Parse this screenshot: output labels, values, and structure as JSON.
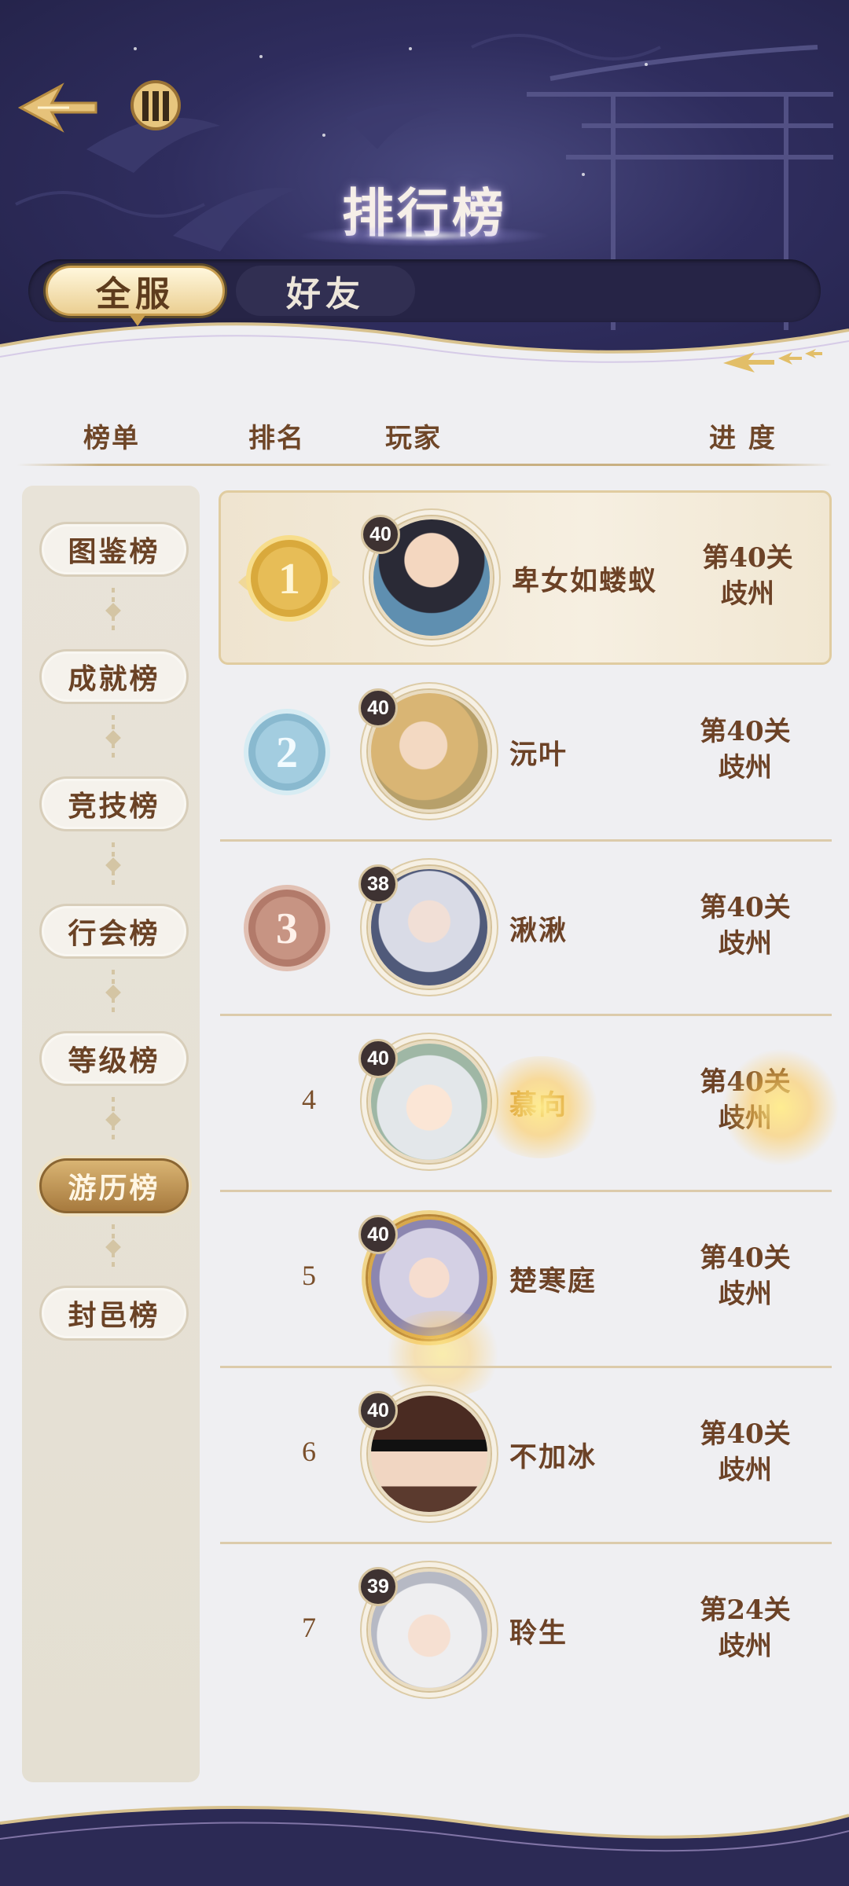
{
  "header": {
    "title": "排行榜",
    "back_icon": "back-arrow-icon",
    "guide_icon": "scroll-book-icon"
  },
  "tabs": [
    {
      "label": "全服",
      "active": true
    },
    {
      "label": "好友",
      "active": false
    }
  ],
  "columns": {
    "list": "榜单",
    "rank": "排名",
    "player": "玩家",
    "progress": "进 度"
  },
  "sidebar": {
    "items": [
      {
        "label": "图鉴榜",
        "active": false
      },
      {
        "label": "成就榜",
        "active": false
      },
      {
        "label": "竞技榜",
        "active": false
      },
      {
        "label": "行会榜",
        "active": false
      },
      {
        "label": "等级榜",
        "active": false
      },
      {
        "label": "游历榜",
        "active": true
      },
      {
        "label": "封邑榜",
        "active": false
      }
    ]
  },
  "rows": [
    {
      "rank": "1",
      "level": "40",
      "name": "卑女如蝼蚁",
      "stage": "第40关",
      "region": "歧州"
    },
    {
      "rank": "2",
      "level": "40",
      "name": "沅叶",
      "stage": "第40关",
      "region": "歧州"
    },
    {
      "rank": "3",
      "level": "38",
      "name": "湫湫",
      "stage": "第40关",
      "region": "歧州"
    },
    {
      "rank": "4",
      "level": "40",
      "name": "慕向",
      "stage": "第40关",
      "region": "歧州"
    },
    {
      "rank": "5",
      "level": "40",
      "name": "楚寒庭",
      "stage": "第40关",
      "region": "歧州"
    },
    {
      "rank": "6",
      "level": "40",
      "name": "不加冰",
      "stage": "第40关",
      "region": "歧州"
    },
    {
      "rank": "7",
      "level": "39",
      "name": "聆生",
      "stage": "第24关",
      "region": "歧州"
    }
  ],
  "colors": {
    "night_sky": "#2f2d5e",
    "gold": "#d9b473",
    "text_brown": "#6c4226",
    "panel": "#efeff2"
  }
}
